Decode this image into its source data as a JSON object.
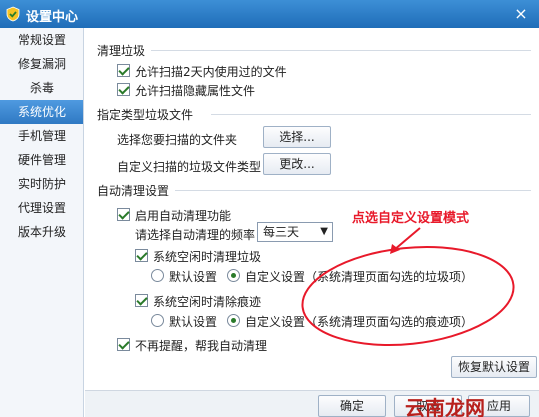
{
  "window": {
    "title": "设置中心",
    "close": "×"
  },
  "sidebar": {
    "items": [
      {
        "label": "常规设置"
      },
      {
        "label": "修复漏洞"
      },
      {
        "label": "杀毒"
      },
      {
        "label": "系统优化"
      },
      {
        "label": "手机管理"
      },
      {
        "label": "硬件管理"
      },
      {
        "label": "实时防护"
      },
      {
        "label": "代理设置"
      },
      {
        "label": "版本升级"
      }
    ]
  },
  "clean": {
    "title": "清理垃圾",
    "opt1": "允许扫描2天内使用过的文件",
    "opt2": "允许扫描隐藏属性文件"
  },
  "specific": {
    "title": "指定类型垃圾文件",
    "folder_label": "选择您要扫描的文件夹",
    "folder_button": "选择...",
    "type_label": "自定义扫描的垃圾文件类型",
    "type_button": "更改..."
  },
  "auto": {
    "title": "自动清理设置",
    "enable": "启用自动清理功能",
    "freq_label": "请选择自动清理的频率：",
    "freq_value": "每三天",
    "freq_arrow": "▼",
    "junk_idle": "系统空闲时清理垃圾",
    "junk_default": "默认设置",
    "junk_custom": "自定义设置（系统清理页面勾选的垃圾项）",
    "trace_idle": "系统空闲时清除痕迹",
    "trace_default": "默认设置",
    "trace_custom": "自定义设置（系统清理页面勾选的痕迹项）",
    "no_remind": "不再提醒，帮我自动清理"
  },
  "annotation": {
    "text": "点选自定义设置模式",
    "color": "#e8192a"
  },
  "buttons": {
    "restore": "恢复默认设置",
    "ok": "确定",
    "cancel": "取消",
    "apply": "应用"
  },
  "watermark": "云南龙网"
}
